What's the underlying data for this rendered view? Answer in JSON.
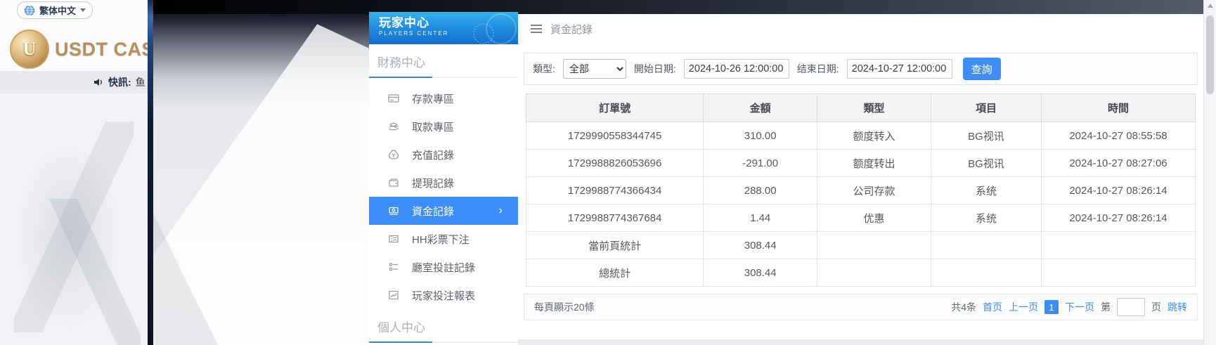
{
  "colors": {
    "accent": "#3d8ef8",
    "sidebar_header_top": "#36b3ee",
    "sidebar_header_bottom": "#146fd0",
    "brand_gold": "#b8905c"
  },
  "language": {
    "label": "繁体中文"
  },
  "brand": {
    "name": "USDT CASINO",
    "logo_letter": "U"
  },
  "news": {
    "label": "快訊:",
    "ticker_text": "鱼"
  },
  "player_center": {
    "title": "玩家中心",
    "subtitle": "PLAYERS CENTER"
  },
  "sidebar": {
    "sections": [
      {
        "title": "財務中心"
      },
      {
        "title": "個人中心"
      }
    ],
    "menu": [
      {
        "label": "存款專區",
        "icon": "deposit-card-icon",
        "active": false
      },
      {
        "label": "取款專區",
        "icon": "withdraw-hand-icon",
        "active": false
      },
      {
        "label": "充值記錄",
        "icon": "recharge-moneybag-icon",
        "active": false
      },
      {
        "label": "提現記錄",
        "icon": "withdrawal-wallet-icon",
        "active": false
      },
      {
        "label": "資金記錄",
        "icon": "funds-record-icon",
        "active": true,
        "chevron": "›"
      },
      {
        "label": "HH彩票下注",
        "icon": "lottery-ticket-icon",
        "active": false
      },
      {
        "label": "廳室投註記錄",
        "icon": "hall-record-icon",
        "active": false
      },
      {
        "label": "玩家投注報表",
        "icon": "report-chart-icon",
        "active": false
      }
    ]
  },
  "topbar": {
    "title": "資金記錄"
  },
  "filters": {
    "type_label": "類型:",
    "type_value": "全部",
    "start_label": "開始日期:",
    "start_value": "2024-10-26 12:00:00",
    "end_label": "结束日期:",
    "end_value": "2024-10-27 12:00:00",
    "search_button": "查詢"
  },
  "table": {
    "headers": [
      "訂單號",
      "金額",
      "類型",
      "項目",
      "時間"
    ],
    "rows": [
      [
        "1729990558344745",
        "310.00",
        "额度转入",
        "BG视讯",
        "2024-10-27 08:55:58"
      ],
      [
        "1729988826053696",
        "-291.00",
        "额度转出",
        "BG视讯",
        "2024-10-27 08:27:06"
      ],
      [
        "1729988774366434",
        "288.00",
        "公司存款",
        "系统",
        "2024-10-27 08:26:14"
      ],
      [
        "1729988774367684",
        "1.44",
        "优惠",
        "系统",
        "2024-10-27 08:26:14"
      ],
      [
        "當前頁統計",
        "308.44",
        "",
        "",
        ""
      ],
      [
        "總統計",
        "308.44",
        "",
        "",
        ""
      ]
    ]
  },
  "pagination": {
    "page_size_text": "每頁顯示20條",
    "total_text": "共4条",
    "first": "首页",
    "prev": "上一页",
    "current_page": "1",
    "next": "下一页",
    "jump_pre": "第",
    "jump_value": "",
    "jump_post": "页",
    "jump_button": "跳转"
  }
}
